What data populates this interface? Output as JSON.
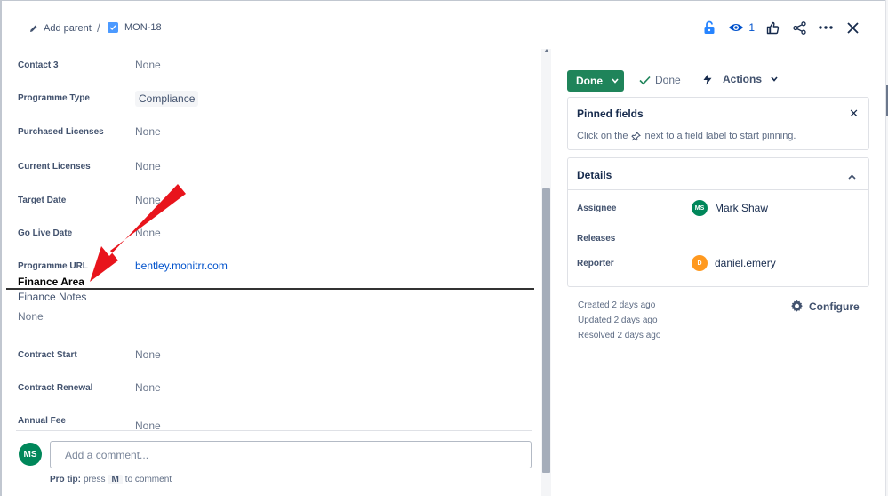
{
  "breadcrumb": {
    "add_parent": "Add parent",
    "separator": "/",
    "issue_key": "MON-18"
  },
  "toolbar": {
    "watch_count": "1"
  },
  "fields": [
    {
      "label": "Contact 3",
      "value": "None"
    },
    {
      "label": "Programme Type",
      "value": "Compliance"
    },
    {
      "label": "Purchased Licenses",
      "value": "None"
    },
    {
      "label": "Current Licenses",
      "value": "None"
    },
    {
      "label": "Target Date",
      "value": "None"
    },
    {
      "label": "Go Live Date",
      "value": "None"
    },
    {
      "label": "Programme URL",
      "value": "bentley.monitrr.com"
    }
  ],
  "finance": {
    "heading": "Finance Area",
    "notes_label": "Finance Notes",
    "notes_value": "None",
    "fields": [
      {
        "label": "Contract Start",
        "value": "None"
      },
      {
        "label": "Contract Renewal",
        "value": "None"
      },
      {
        "label": "Annual Fee",
        "value": "None"
      }
    ]
  },
  "comment": {
    "avatar_initials": "MS",
    "placeholder": "Add a comment...",
    "pro_tip_label": "Pro tip:",
    "pro_tip_press": "press",
    "pro_tip_key": "M",
    "pro_tip_suffix": "to comment"
  },
  "status": {
    "button_label": "Done",
    "resolution_label": "Done",
    "actions_label": "Actions"
  },
  "pinned": {
    "title": "Pinned fields",
    "hint_before": "Click on the",
    "hint_after": "next to a field label to start pinning."
  },
  "details": {
    "title": "Details",
    "assignee_label": "Assignee",
    "assignee_name": "Mark Shaw",
    "assignee_initials": "MS",
    "releases_label": "Releases",
    "reporter_label": "Reporter",
    "reporter_name": "daniel.emery",
    "reporter_initials": "D"
  },
  "meta": {
    "created": "Created 2 days ago",
    "updated": "Updated 2 days ago",
    "resolved": "Resolved 2 days ago",
    "configure_label": "Configure"
  },
  "annotation": {
    "arrow_color": "#e8141c"
  },
  "colors": {
    "done_green": "#1f845a",
    "link_blue": "#0052cc",
    "assignee_avatar": "#00875a",
    "reporter_avatar": "#ff991f"
  }
}
